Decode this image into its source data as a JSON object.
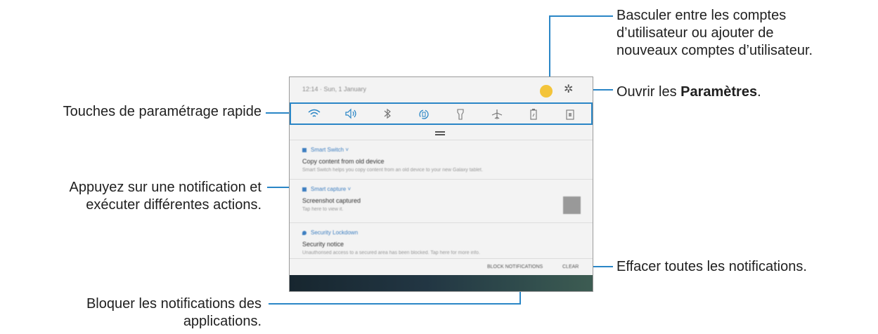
{
  "callouts": {
    "switch_user": [
      "Basculer entre les comptes",
      "d’utilisateur ou ajouter de",
      "nouveaux comptes d’utilisateur."
    ],
    "open_settings_prefix": "Ouvrir les ",
    "open_settings_bold": "Paramètres",
    "open_settings_suffix": ".",
    "quick_settings": "Touches de paramétrage rapide",
    "tap_notification": [
      "Appuyez sur une notification et",
      "exécuter différentes actions."
    ],
    "clear_all": "Effacer toutes les notifications.",
    "block_notifications": [
      "Bloquer les notifications des",
      "applications."
    ]
  },
  "panel": {
    "status_text": "12:14 · Sun, 1 January",
    "quick_icons": [
      "wifi-icon",
      "sound-icon",
      "bluetooth-icon",
      "auto-rotate-icon",
      "flashlight-icon",
      "airplane-icon",
      "power-saving-icon",
      "screen-icon"
    ],
    "notifications": [
      {
        "app": "Smart Switch",
        "title": "Copy content from old device",
        "body": "Smart Switch helps you copy content from an old device to your new Galaxy tablet."
      },
      {
        "app": "Smart capture",
        "title": "Screenshot captured",
        "body": "Tap here to view it."
      },
      {
        "app": "Security Lockdown",
        "title": "Security notice",
        "body": "Unauthorised access to a secured area has been blocked. Tap here for more info."
      }
    ],
    "block_label": "BLOCK NOTIFICATIONS",
    "clear_label": "CLEAR"
  },
  "colors": {
    "accent_line": "#2a86c6",
    "avatar": "#f3c43a"
  }
}
